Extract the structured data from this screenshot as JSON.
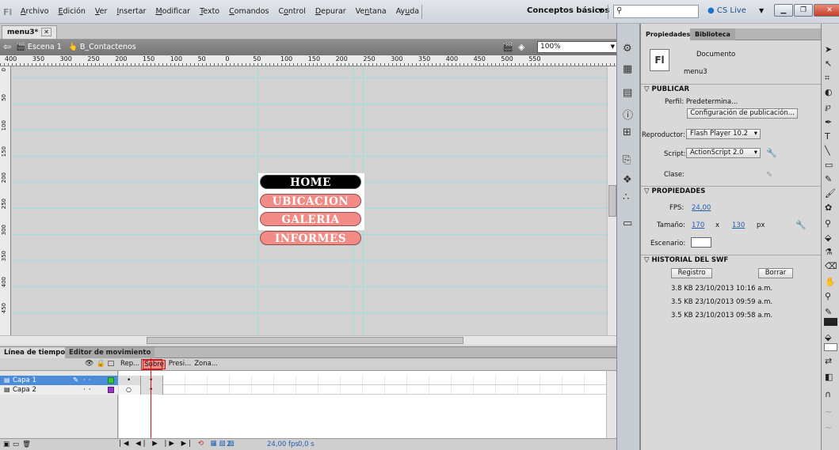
{
  "menubar": {
    "logo": "Fl",
    "items": [
      {
        "label": "Archivo",
        "ul": "A"
      },
      {
        "label": "Edición",
        "ul": "E"
      },
      {
        "label": "Ver",
        "ul": "V"
      },
      {
        "label": "Insertar",
        "ul": "I"
      },
      {
        "label": "Modificar",
        "ul": "M"
      },
      {
        "label": "Texto",
        "ul": "T"
      },
      {
        "label": "Comandos",
        "ul": "C"
      },
      {
        "label": "Control",
        "ul": "o"
      },
      {
        "label": "Depurar",
        "ul": "D"
      },
      {
        "label": "Ventana",
        "ul": "n"
      },
      {
        "label": "Ayuda",
        "ul": "u"
      }
    ],
    "workspace": "Conceptos básicos",
    "search_placeholder": "",
    "cs_live": "CS Live"
  },
  "document": {
    "tab": "menu3*",
    "scene": "Escena 1",
    "symbol": "B_Contactenos",
    "zoom": "100%"
  },
  "ruler": {
    "h_ticks": [
      "400",
      "350",
      "300",
      "250",
      "200",
      "150",
      "100",
      "50",
      "0",
      "50",
      "100",
      "150",
      "200",
      "250",
      "300",
      "350",
      "400",
      "450",
      "500",
      "550"
    ],
    "v_ticks": [
      "0",
      "50",
      "100",
      "150",
      "200",
      "250",
      "300",
      "350",
      "400",
      "450"
    ]
  },
  "stage": {
    "buttons": [
      {
        "label": "HOME",
        "state": "selected"
      },
      {
        "label": "UBICACION",
        "state": "normal"
      },
      {
        "label": "GALERIA",
        "state": "normal"
      },
      {
        "label": "INFORMES",
        "state": "normal"
      }
    ]
  },
  "timeline": {
    "tab1": "Línea de tiempo",
    "tab2": "Editor de movimiento",
    "frame_labels": [
      "Rep...",
      "Sobre",
      "Presi...",
      "Zona..."
    ],
    "layers": [
      {
        "name": "Capa 1",
        "selected": true,
        "color": "#33cc33"
      },
      {
        "name": "Capa 2",
        "selected": false,
        "color": "#9933cc"
      }
    ],
    "current_frame": "2",
    "fps": "24,00 fps",
    "time": "0,0 s"
  },
  "properties": {
    "tab1": "Propiedades",
    "tab2": "Biblioteca",
    "doc_icon": "Fl",
    "doc_type": "Documento",
    "doc_name": "menu3",
    "publicar_head": "PUBLICAR",
    "perfil": "Perfil: Predetermina...",
    "config_btn": "Configuración de publicación...",
    "reproductor_label": "Reproductor:",
    "reproductor_value": "Flash Player 10.2",
    "script_label": "Script:",
    "script_value": "ActionScript 2.0",
    "clase_label": "Clase:",
    "propiedades_head": "PROPIEDADES",
    "fps_label": "FPS:",
    "fps_value": "24,00",
    "tamano_label": "Tamaño:",
    "width": "170",
    "x": "x",
    "height": "130",
    "unit": "px",
    "escenario_label": "Escenario:",
    "historial_head": "HISTORIAL DEL SWF",
    "registro_btn": "Registro",
    "borrar_btn": "Borrar",
    "history": [
      "3.8 KB  23/10/2013  10:16 a.m.",
      "3.5 KB  23/10/2013  09:59 a.m.",
      "3.5 KB  23/10/2013  09:58 a.m."
    ]
  }
}
